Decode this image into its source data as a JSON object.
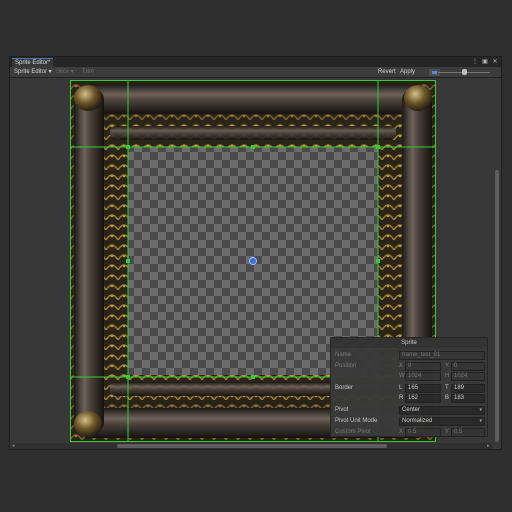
{
  "window": {
    "tab_title": "Sprite Editor*"
  },
  "toolbar": {
    "mode_label": "Sprite Editor",
    "slice_label": "Slice",
    "trim_label": "Trim",
    "revert_label": "Revert",
    "apply_label": "Apply"
  },
  "scrollbars": {
    "left_arrow": "◂",
    "right_arrow": "▸"
  },
  "sprite_panel": {
    "title": "Sprite",
    "name_label": "Name",
    "name_value": "frame_test_01",
    "position_label": "Position",
    "pos_x_label": "X",
    "pos_x": "0",
    "pos_y_label": "Y",
    "pos_y": "0",
    "pos_w_label": "W",
    "pos_w": "1024",
    "pos_h_label": "H",
    "pos_h": "1024",
    "border_label": "Border",
    "border_l_label": "L",
    "border_l": "165",
    "border_t_label": "T",
    "border_t": "189",
    "border_r_label": "R",
    "border_r": "162",
    "border_b_label": "B",
    "border_b": "183",
    "pivot_label": "Pivot",
    "pivot_value": "Center",
    "pivot_unit_label": "Pivot Unit Mode",
    "pivot_unit_value": "Normalized",
    "custom_pivot_label": "Custom Pivot",
    "custom_x_label": "X",
    "custom_x": "0.5",
    "custom_y_label": "Y",
    "custom_y": "0.5"
  },
  "colors": {
    "slice_line": "#2fd12f",
    "pivot_handle": "#3b6fd6",
    "frame_dark": "#2a231b",
    "frame_gold": "#8a6a2a"
  },
  "icons": {
    "dropdown": "chevron-down-icon",
    "more": "kebab-icon",
    "maximize": "maximize-icon",
    "close": "close-icon"
  }
}
